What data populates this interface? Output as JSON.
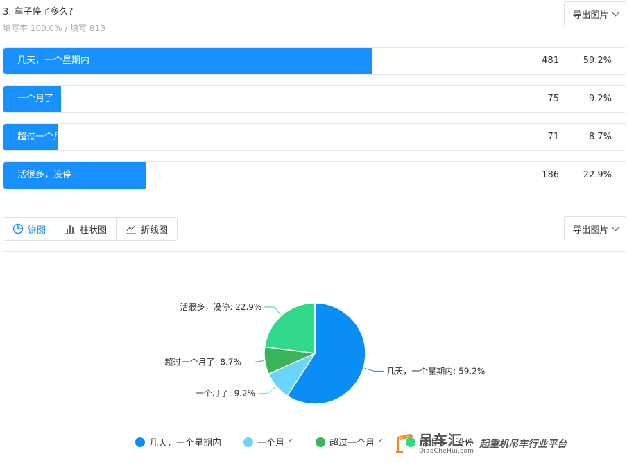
{
  "question": {
    "title": "3. 车子停了多久?",
    "meta": "填写率 100.0% / 填写 813"
  },
  "export_label": "导出图片",
  "options": [
    {
      "label": "几天，一个星期内",
      "count": "481",
      "pct": "59.2%",
      "ratio": 0.592
    },
    {
      "label": "一个月了",
      "count": "75",
      "pct": "9.2%",
      "ratio": 0.092
    },
    {
      "label": "超过一个月了",
      "count": "71",
      "pct": "8.7%",
      "ratio": 0.087
    },
    {
      "label": "活很多，没停",
      "count": "186",
      "pct": "22.9%",
      "ratio": 0.229
    }
  ],
  "chart_tabs": [
    {
      "label": "饼图",
      "icon": "pie-chart-icon"
    },
    {
      "label": "柱状图",
      "icon": "bar-chart-icon"
    },
    {
      "label": "折线图",
      "icon": "line-chart-icon"
    }
  ],
  "chart_data": {
    "type": "pie",
    "categories": [
      "几天，一个星期内",
      "一个月了",
      "超过一个月了",
      "活很多，没停"
    ],
    "values": [
      59.2,
      9.2,
      8.7,
      22.9
    ],
    "counts": [
      481,
      75,
      71,
      186
    ],
    "slice_labels": [
      "几天，一个星期内: 59.2%",
      "一个月了: 9.2%",
      "超过一个月了: 8.7%",
      "活很多，没停: 22.9%"
    ],
    "colors": [
      "#0a8ef5",
      "#6ad5fb",
      "#3bb55a",
      "#33d98a"
    ],
    "legend_position": "bottom"
  },
  "watermark": {
    "logo": "吊车汇",
    "url": "DiaoCheHui.com",
    "slogan": "起重机吊车行业平台"
  }
}
